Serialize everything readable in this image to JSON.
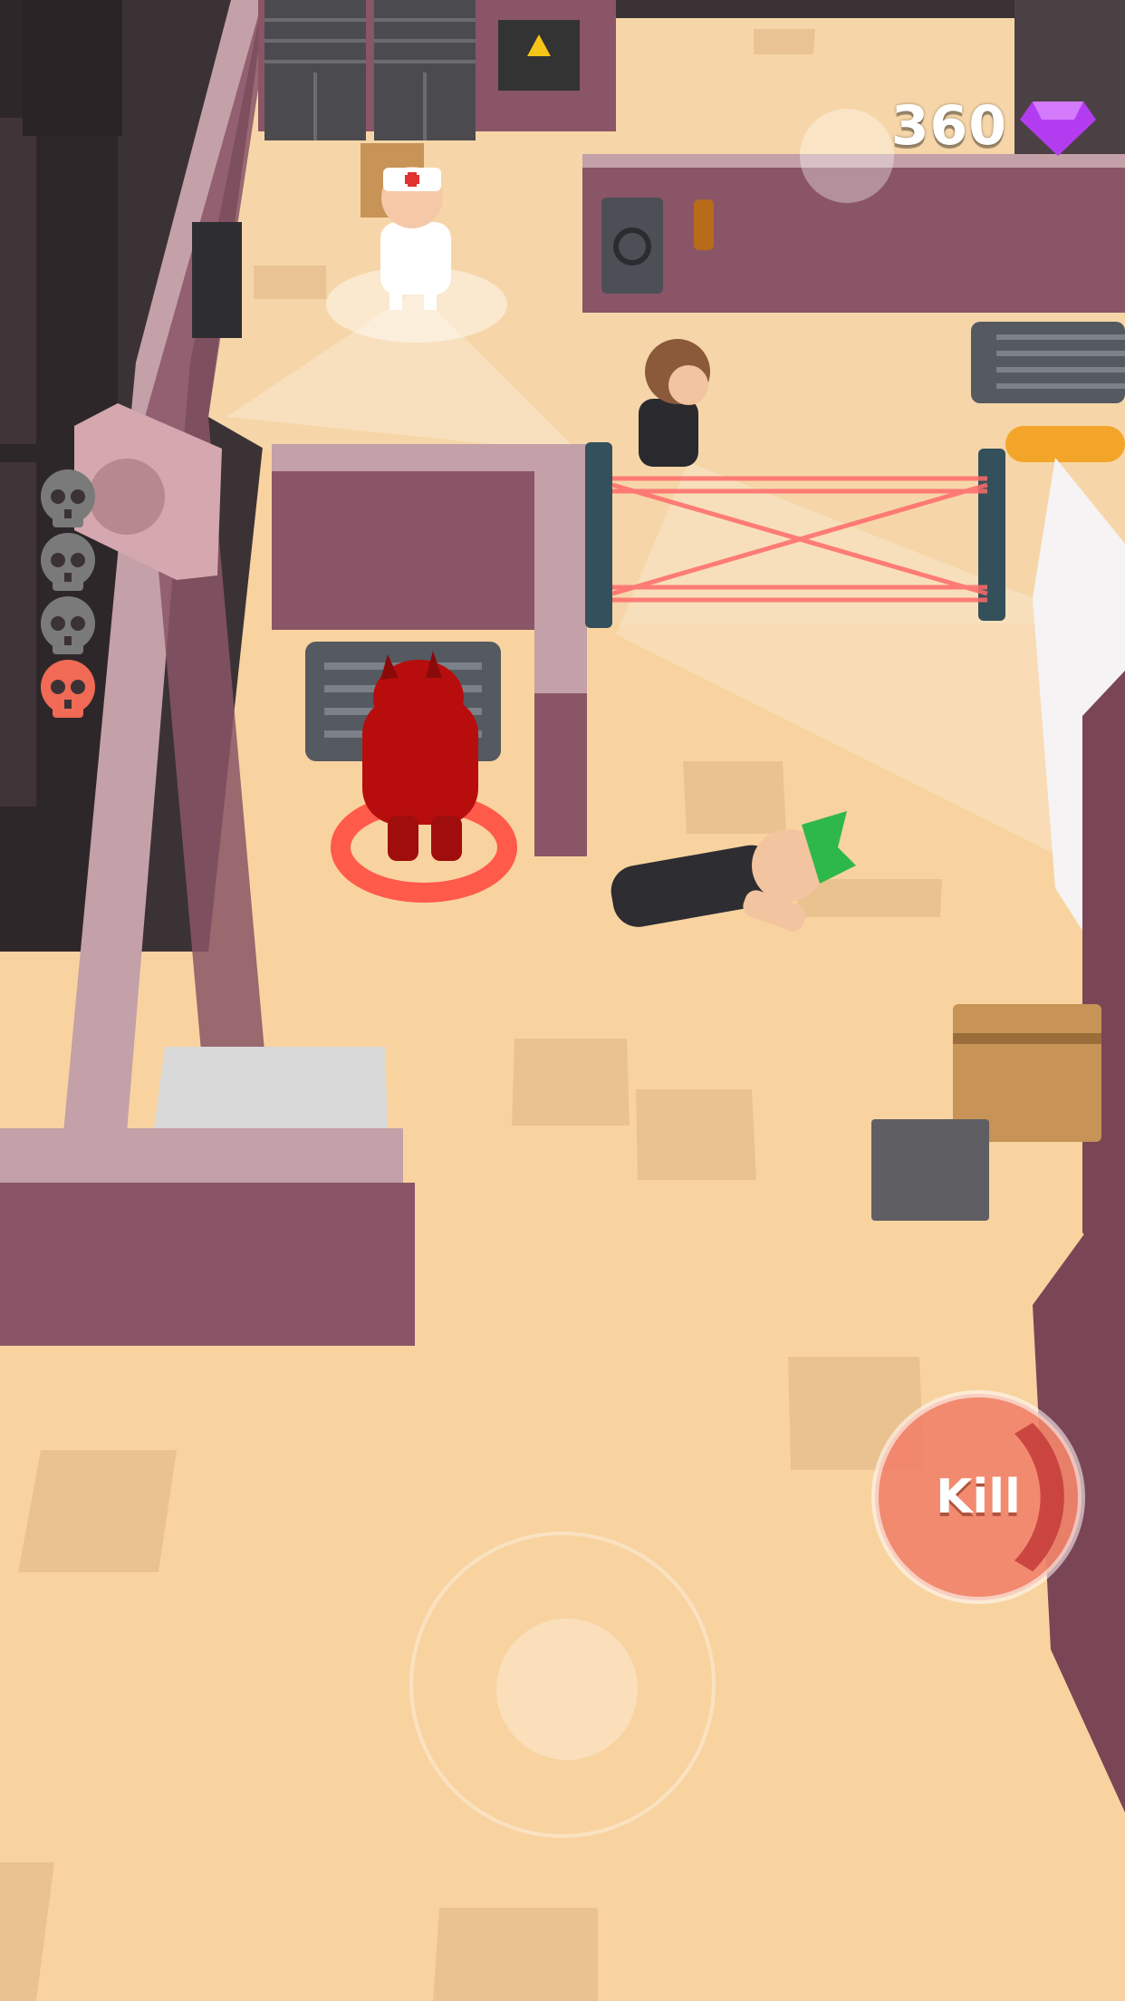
{
  "hud": {
    "gem_count": "360",
    "gem_icon": "purple-diamond-icon",
    "gem_color": "#b43cf0"
  },
  "kills": {
    "total_targets": 4,
    "completed": 1,
    "skull_icon": "skull-icon",
    "inactive_color": "#7a7a7a",
    "active_color": "#f06a55"
  },
  "controls": {
    "kill_label": "Kill",
    "kill_color": "#f2846b",
    "joystick_icon": "virtual-joystick"
  },
  "colors": {
    "floor": "#f8d3a0",
    "wall_top": "#c4a0a8",
    "wall_side": "#8a5566",
    "laser": "#ff5a5a",
    "player": "#b80d0d",
    "target_ring": "#ff5a4a"
  }
}
